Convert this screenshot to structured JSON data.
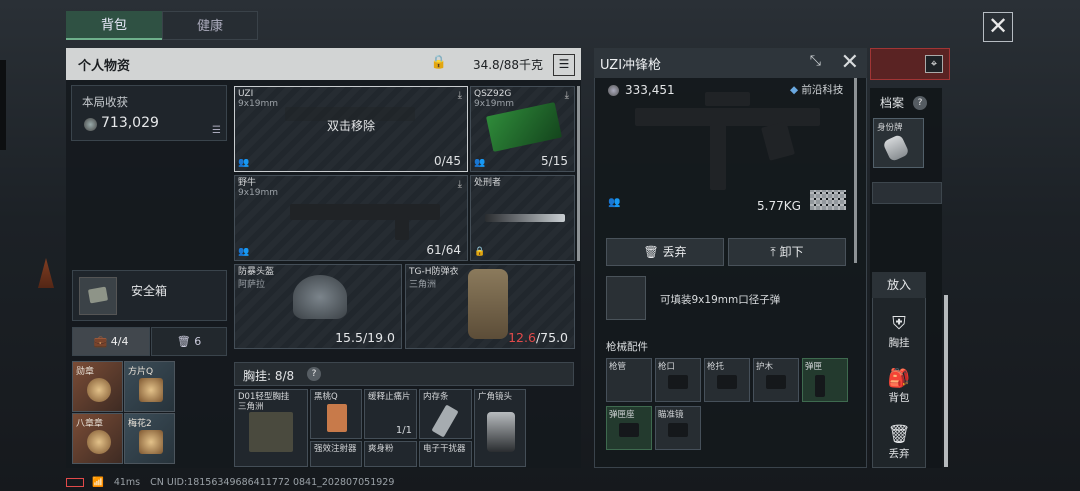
{
  "tabs": [
    {
      "label": "背包",
      "active": true
    },
    {
      "label": "健康",
      "active": false
    }
  ],
  "inventory": {
    "title": "个人物资",
    "weight": "34.8/88千克",
    "earnings_label": "本局收获",
    "earnings_value": "713,029",
    "safe_box_label": "安全箱",
    "filters": [
      {
        "label": "4/4"
      },
      {
        "label": "6"
      }
    ],
    "minis": [
      {
        "name": "勋章"
      },
      {
        "name": "方片Q"
      },
      {
        "name": "八章章"
      },
      {
        "name": "梅花2"
      }
    ]
  },
  "slots": {
    "uzi": {
      "name": "UZI",
      "caliber": "9x19mm",
      "overlay": "双击移除",
      "ammo": "0/45"
    },
    "qsz": {
      "name": "QSZ92G",
      "caliber": "9x19mm",
      "ammo": "5/15"
    },
    "yeniu": {
      "name": "野牛",
      "caliber": "9x19mm",
      "ammo": "61/64"
    },
    "exec": {
      "name": "处刑者"
    },
    "helmet": {
      "name": "防暴头盔",
      "sub": "阿萨拉",
      "dur": "15.5/19.0"
    },
    "vest": {
      "name": "TG-H防弹衣",
      "sub": "三角洲",
      "dur_cur": "12.6",
      "dur_max": "/75.0"
    }
  },
  "chest": {
    "title": "胸挂: 8/8",
    "items": [
      {
        "name": "D01轻型胸挂\n三角洲"
      },
      {
        "name": "黑桃Q"
      },
      {
        "name": "强效注射器"
      },
      {
        "name": "缓释止痛片",
        "count": "1/1"
      },
      {
        "name": "爽身粉"
      },
      {
        "name": "内存条"
      },
      {
        "name": "电子干扰器"
      },
      {
        "name": "广角镜头"
      }
    ]
  },
  "detail": {
    "title": "UZI冲锋枪",
    "price": "333,451",
    "brand": "前沿科技",
    "weight": "5.77KG",
    "discard_label": "丢弃",
    "unload_label": "卸下",
    "ammo_desc": "可填装9x19mm口径子弹",
    "accessories_title": "枪械配件",
    "accessories": [
      {
        "name": "枪管",
        "filled": false
      },
      {
        "name": "枪口",
        "filled": false
      },
      {
        "name": "枪托",
        "filled": false
      },
      {
        "name": "护木",
        "filled": false
      },
      {
        "name": "弹匣",
        "filled": true
      },
      {
        "name": "弹匣座",
        "filled": true
      },
      {
        "name": "瞄准镜",
        "filled": false
      }
    ]
  },
  "archive": {
    "title": "档案",
    "q": "?",
    "idcard": "身份牌"
  },
  "put": {
    "title": "放入",
    "items": [
      {
        "label": "胸挂"
      },
      {
        "label": "背包"
      },
      {
        "label": "丢弃"
      }
    ]
  },
  "status": {
    "ping": "41ms",
    "uid": "CN UID:18156349686411772 0841_202807051929"
  },
  "colors": {
    "accent": "#6fb08c",
    "warning": "#e24a4a",
    "gold": "#d9b14a"
  }
}
